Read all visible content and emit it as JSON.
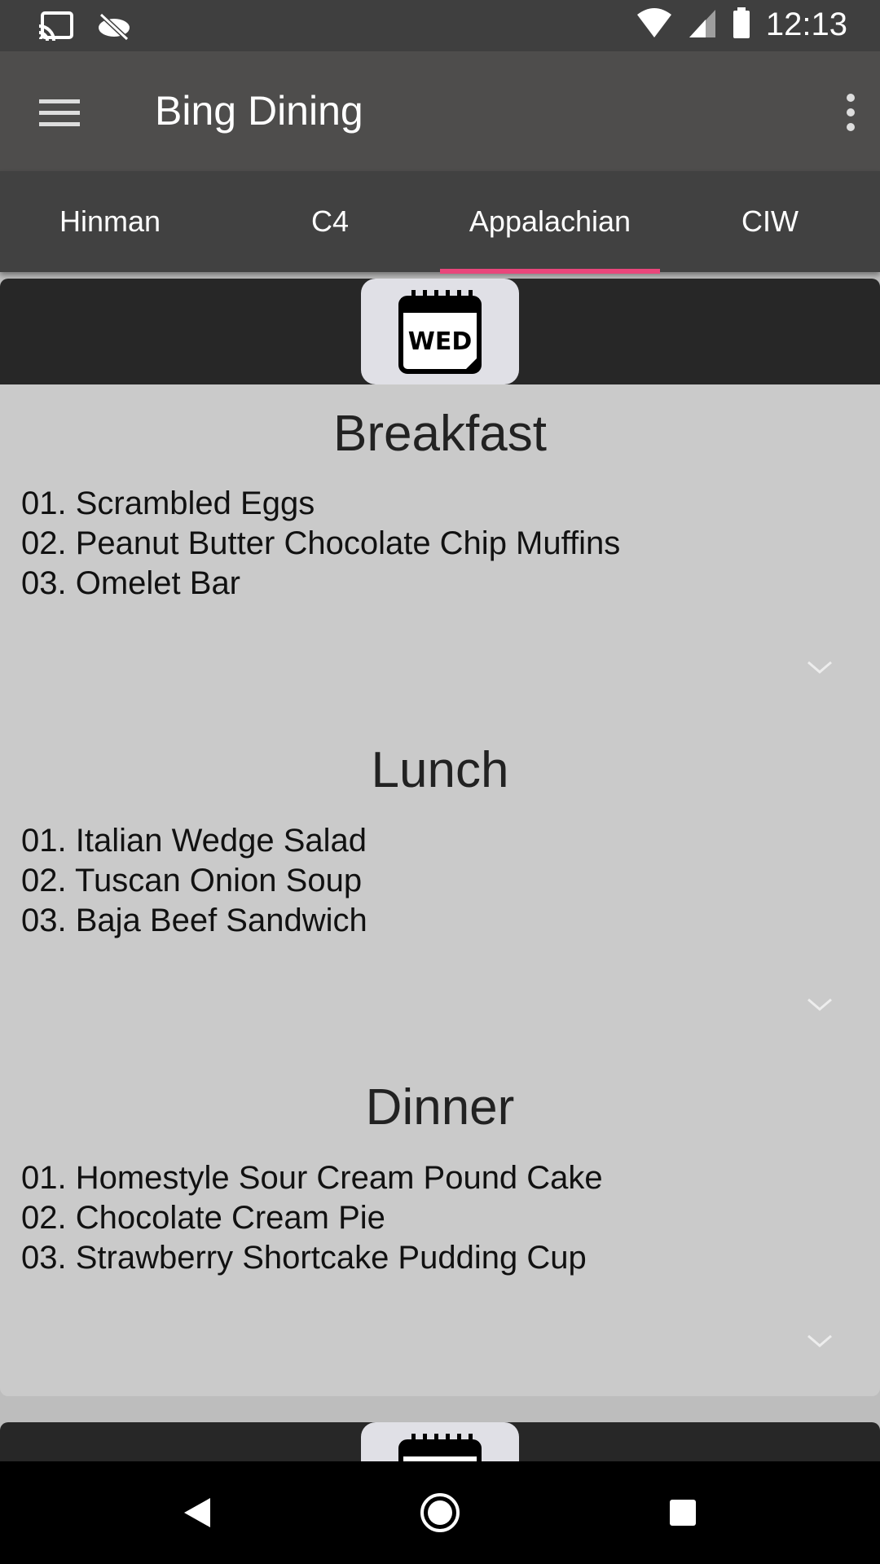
{
  "status_bar": {
    "time": "12:13",
    "icons": [
      "cast-icon",
      "sync-off-icon",
      "wifi-icon",
      "signal-icon",
      "battery-icon"
    ]
  },
  "app_bar": {
    "title": "Bing Dining",
    "menu_icon": "hamburger-menu-icon",
    "overflow_icon": "more-vert-icon"
  },
  "tabs": [
    {
      "label": "Hinman",
      "selected": false
    },
    {
      "label": "C4",
      "selected": false
    },
    {
      "label": "Appalachian",
      "selected": true
    },
    {
      "label": "CIW",
      "selected": false
    }
  ],
  "accent_color": "#e9467b",
  "day_card": {
    "day_icon": "calendar-icon",
    "day_label": "WED",
    "meals": [
      {
        "title": "Breakfast",
        "items": [
          "01. Scrambled Eggs",
          "02. Peanut Butter Chocolate Chip Muffins",
          "03. Omelet Bar"
        ]
      },
      {
        "title": "Lunch",
        "items": [
          "01. Italian Wedge Salad",
          "02. Tuscan Onion Soup",
          "03. Baja Beef Sandwich"
        ]
      },
      {
        "title": "Dinner",
        "items": [
          "01. Homestyle Sour Cream Pound Cake",
          "02. Chocolate Cream Pie",
          "03. Strawberry Shortcake Pudding Cup"
        ]
      }
    ]
  },
  "nav_bar": {
    "icons": [
      "back-icon",
      "home-icon",
      "recents-icon"
    ]
  }
}
